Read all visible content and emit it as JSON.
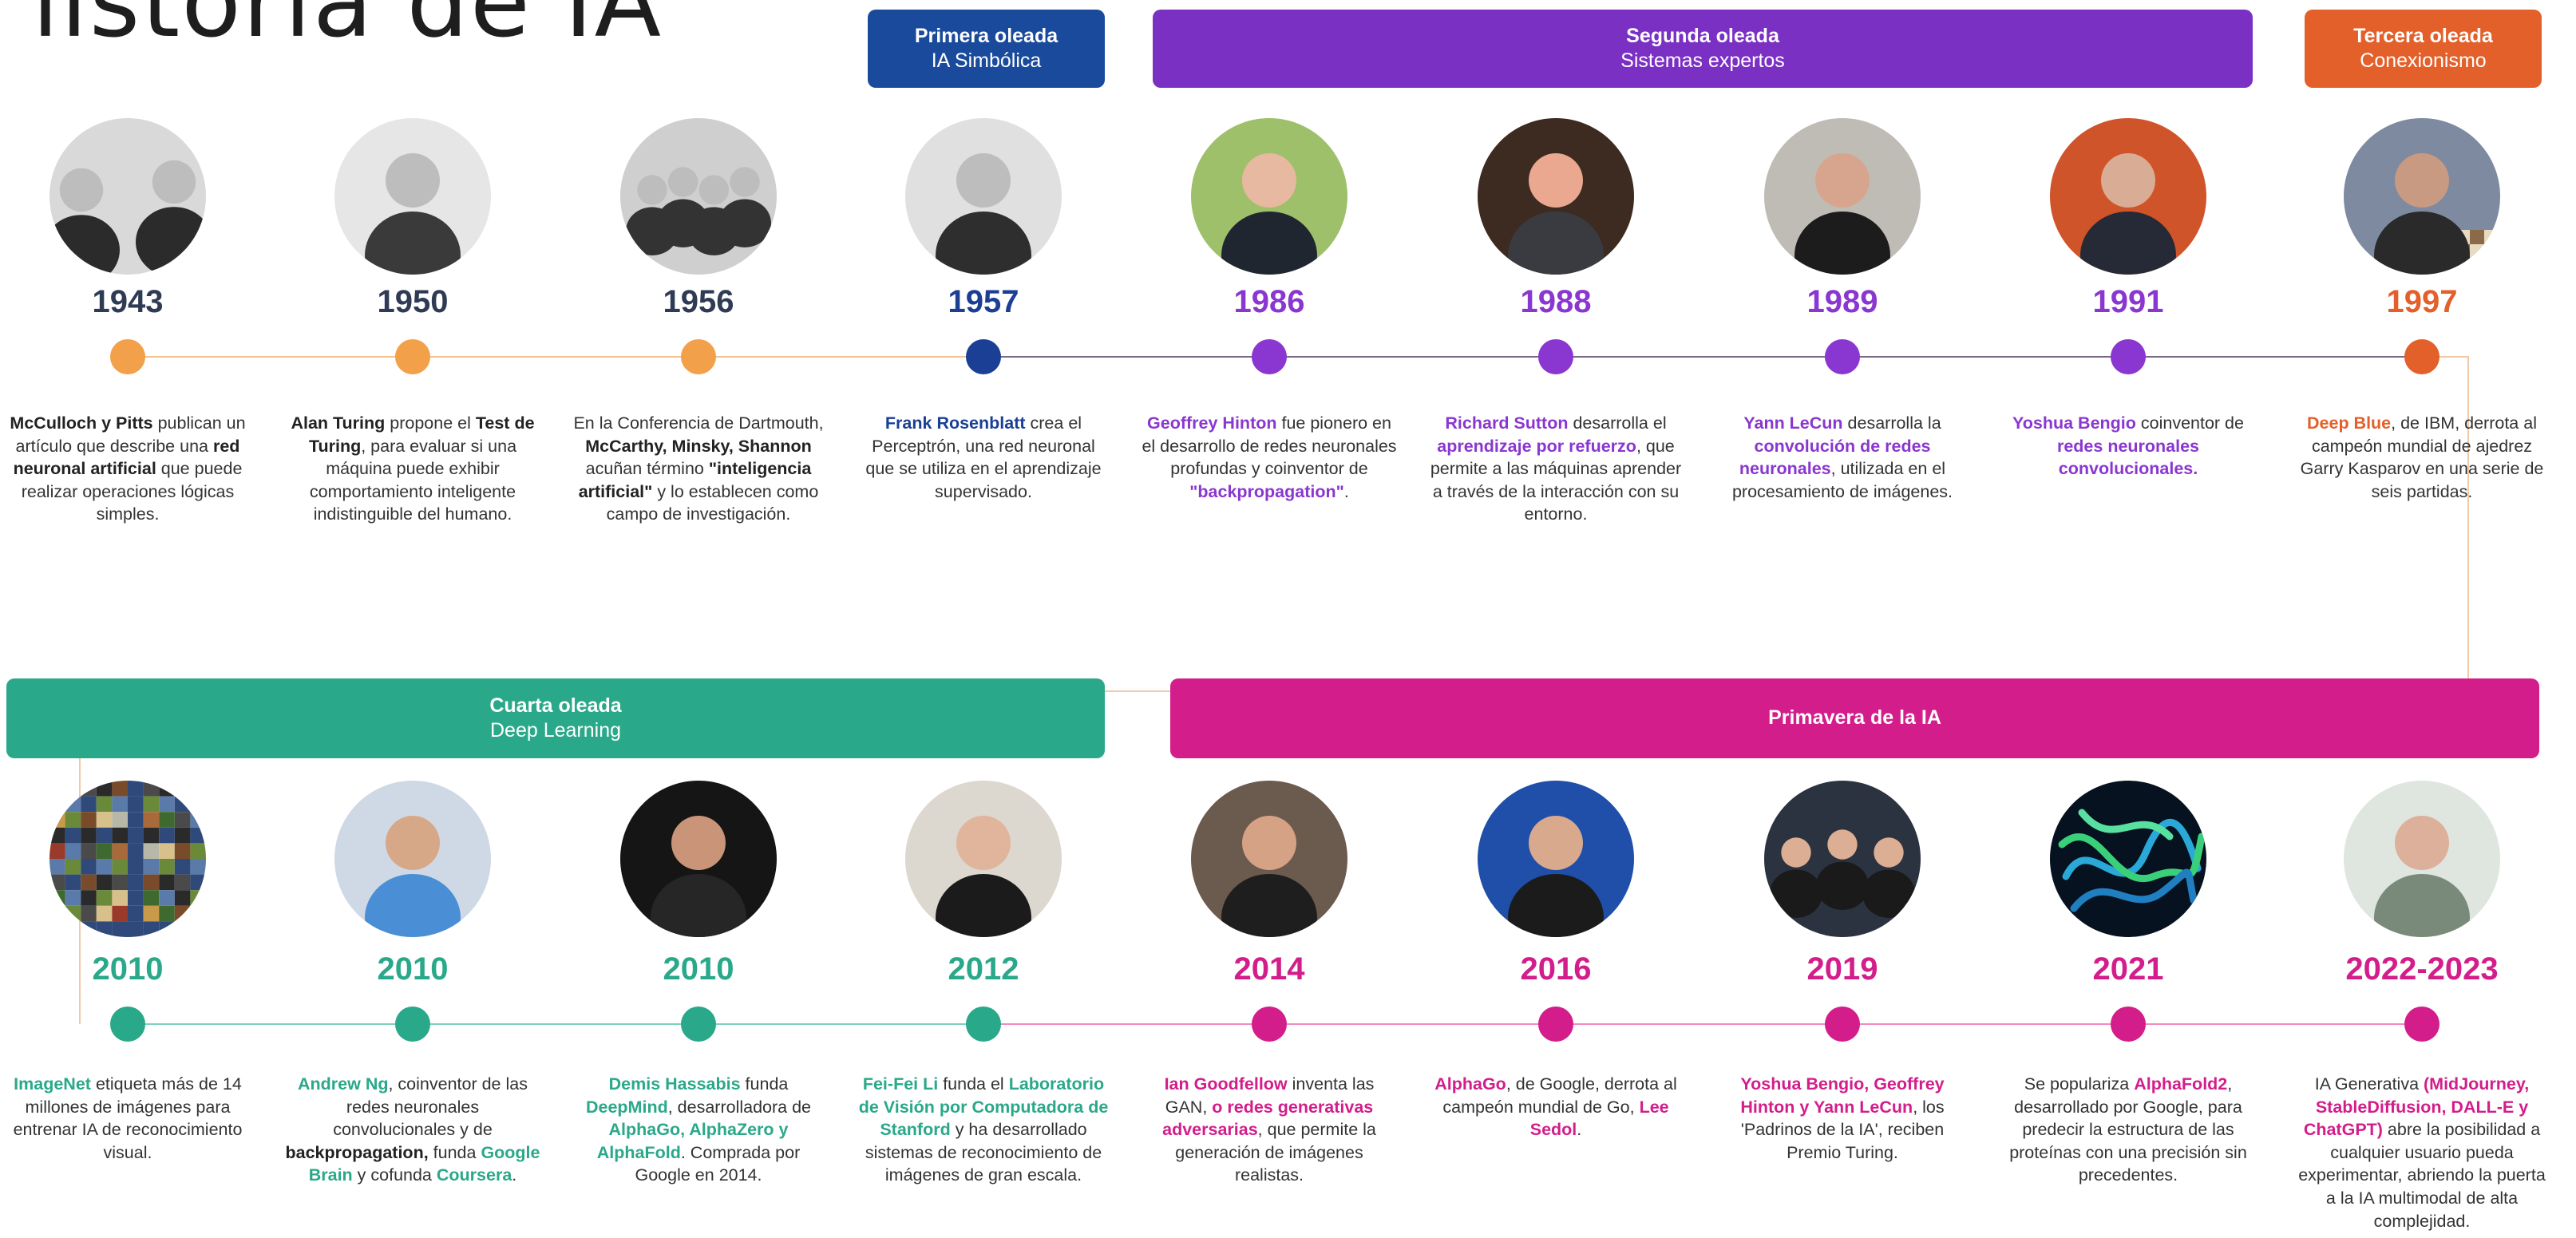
{
  "page_title": "listoria de IA",
  "waves": [
    {
      "title": "Primera oleada",
      "subtitle": "IA Simbólica"
    },
    {
      "title": "Segunda oleada",
      "subtitle": "Sistemas expertos"
    },
    {
      "title": "Tercera oleada",
      "subtitle": "Conexionismo"
    },
    {
      "title": "Cuarta oleada",
      "subtitle": "Deep Learning"
    },
    {
      "title": "Primavera de la IA",
      "subtitle": ""
    }
  ],
  "colors": {
    "early": "#f2a04a",
    "symbolic": "#1a3f94",
    "expert": "#8a36d0",
    "connectionism": "#e3602a",
    "deep_learning": "#2aa88a",
    "spring": "#d31d8b",
    "year_early": "#2f3b55"
  },
  "events_row1": [
    {
      "year": "1943",
      "photo": "mcculloch-pitts-photo",
      "desc": [
        [
          "b",
          "McCulloch y Pitts"
        ],
        [
          "t",
          " publican un artículo que describe una "
        ],
        [
          "b",
          "red neuronal artificial"
        ],
        [
          "t",
          " que puede realizar operaciones lógicas simples."
        ]
      ]
    },
    {
      "year": "1950",
      "photo": "alan-turing-photo",
      "desc": [
        [
          "b",
          "Alan Turing"
        ],
        [
          "t",
          " propone el "
        ],
        [
          "b",
          "Test de Turing"
        ],
        [
          "t",
          ", para evaluar si una máquina puede exhibir comportamiento inteligente indistinguible del humano."
        ]
      ]
    },
    {
      "year": "1956",
      "photo": "dartmouth-conference-photo",
      "desc": [
        [
          "t",
          "En la Conferencia de Dartmouth, "
        ],
        [
          "b",
          "McCarthy, Minsky, Shannon"
        ],
        [
          "t",
          " acuñan término "
        ],
        [
          "b",
          "\"inteligencia artificial\""
        ],
        [
          "t",
          " y lo establecen como campo de investigación."
        ]
      ]
    },
    {
      "year": "1957",
      "photo": "frank-rosenblatt-photo",
      "desc": [
        [
          "c",
          "Frank Rosenblatt"
        ],
        [
          "t",
          " crea el Perceptrón, una red neuronal que se utiliza en el aprendizaje supervisado."
        ]
      ]
    },
    {
      "year": "1986",
      "photo": "geoffrey-hinton-photo",
      "desc": [
        [
          "c",
          "Geoffrey Hinton"
        ],
        [
          "t",
          " fue pionero en el desarrollo de redes neuronales profundas y coinventor de "
        ],
        [
          "c",
          "\"backpropagation\""
        ],
        [
          "t",
          "."
        ]
      ]
    },
    {
      "year": "1988",
      "photo": "richard-sutton-photo",
      "desc": [
        [
          "c",
          "Richard Sutton"
        ],
        [
          "t",
          " desarrolla el "
        ],
        [
          "c",
          "aprendizaje por refuerzo"
        ],
        [
          "t",
          ", que permite a las máquinas aprender a través de la interacción con su entorno."
        ]
      ]
    },
    {
      "year": "1989",
      "photo": "yann-lecun-photo",
      "desc": [
        [
          "c",
          "Yann LeCun"
        ],
        [
          "t",
          " desarrolla la "
        ],
        [
          "c",
          "convolución de redes neuronales"
        ],
        [
          "t",
          ", utilizada en el procesamiento de imágenes."
        ]
      ]
    },
    {
      "year": "1991",
      "photo": "yoshua-bengio-photo",
      "desc": [
        [
          "c",
          "Yoshua Bengio"
        ],
        [
          "t",
          " coinventor de "
        ],
        [
          "c",
          "redes neuronales convolucionales."
        ]
      ]
    },
    {
      "year": "1997",
      "photo": "deep-blue-chess-photo",
      "desc": [
        [
          "c",
          "Deep Blue"
        ],
        [
          "t",
          ", de IBM, derrota al campeón mundial de ajedrez Garry Kasparov en una serie de seis partidas."
        ]
      ]
    }
  ],
  "events_row2": [
    {
      "year": "2010",
      "photo": "imagenet-mosaic-photo",
      "desc": [
        [
          "c",
          "ImageNet"
        ],
        [
          "t",
          " etiqueta más de 14 millones de imágenes para entrenar IA de reconocimiento visual."
        ]
      ]
    },
    {
      "year": "2010",
      "photo": "andrew-ng-photo",
      "desc": [
        [
          "c",
          "Andrew Ng"
        ],
        [
          "t",
          ",  coinventor de las redes neuronales convolucionales y de "
        ],
        [
          "b",
          "backpropagation,"
        ],
        [
          "t",
          " funda "
        ],
        [
          "c",
          "Google Brain"
        ],
        [
          "t",
          " y cofunda "
        ],
        [
          "c",
          "Coursera"
        ],
        [
          "t",
          "."
        ]
      ]
    },
    {
      "year": "2010",
      "photo": "demis-hassabis-photo",
      "desc": [
        [
          "c",
          "Demis Hassabis"
        ],
        [
          "t",
          " funda "
        ],
        [
          "c",
          "DeepMind"
        ],
        [
          "t",
          ", desarrolladora de "
        ],
        [
          "c",
          "AlphaGo, AlphaZero y AlphaFold"
        ],
        [
          "t",
          ". Comprada por Google en 2014."
        ]
      ]
    },
    {
      "year": "2012",
      "photo": "fei-fei-li-photo",
      "desc": [
        [
          "c",
          "Fei-Fei Li"
        ],
        [
          "t",
          " funda el "
        ],
        [
          "c",
          "Laboratorio de Visión por Computadora de Stanford"
        ],
        [
          "t",
          " y ha desarrollado sistemas de reconocimiento de imágenes de gran escala."
        ]
      ]
    },
    {
      "year": "2014",
      "photo": "ian-goodfellow-photo",
      "desc": [
        [
          "c",
          "Ian Goodfellow"
        ],
        [
          "t",
          " inventa las GAN, "
        ],
        [
          "c",
          "o redes generativas adversarias"
        ],
        [
          "t",
          ", que permite la generación de imágenes realistas."
        ]
      ]
    },
    {
      "year": "2016",
      "photo": "alphago-lee-sedol-photo",
      "desc": [
        [
          "c",
          "AlphaGo"
        ],
        [
          "t",
          ", de Google, derrota al campeón mundial de Go, "
        ],
        [
          "c",
          "Lee Sedol"
        ],
        [
          "t",
          "."
        ]
      ]
    },
    {
      "year": "2019",
      "photo": "turing-award-photo",
      "desc": [
        [
          "c",
          "Yoshua Bengio, Geoffrey Hinton y Yann LeCun"
        ],
        [
          "t",
          ", los 'Padrinos de la IA', reciben Premio Turing."
        ]
      ]
    },
    {
      "year": "2021",
      "photo": "alphafold-protein-photo",
      "desc": [
        [
          "t",
          "Se populariza "
        ],
        [
          "c",
          "AlphaFold2"
        ],
        [
          "t",
          ", desarrollado por Google, para predecir la estructura de las proteínas con una precisión sin precedentes."
        ]
      ]
    },
    {
      "year": "2022-2023",
      "photo": "sam-altman-photo",
      "desc": [
        [
          "t",
          "IA Generativa "
        ],
        [
          "c",
          "(MidJourney, StableDiffusion, DALL-E y ChatGPT)"
        ],
        [
          "t",
          " abre la posibilidad a cualquier usuario pueda experimentar, abriendo la puerta a la IA multimodal de alta complejidad."
        ]
      ]
    }
  ]
}
